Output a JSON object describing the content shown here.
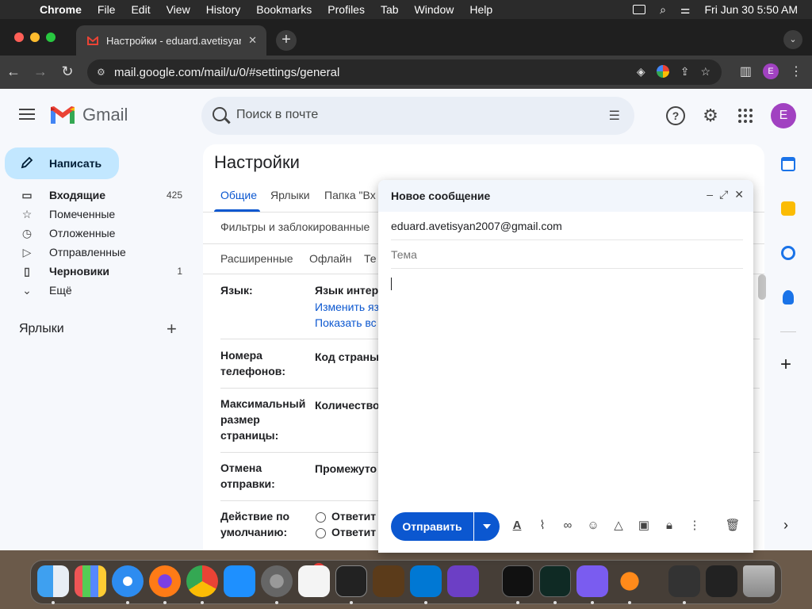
{
  "menubar": {
    "app": "Chrome",
    "items": [
      "File",
      "Edit",
      "View",
      "History",
      "Bookmarks",
      "Profiles",
      "Tab",
      "Window",
      "Help"
    ],
    "clock": "Fri Jun 30  5:50 AM"
  },
  "browser": {
    "tab_title": "Настройки - eduard.avetisyan",
    "url": "mail.google.com/mail/u/0/#settings/general",
    "profile_initial": "E"
  },
  "gmail": {
    "logo_text": "Gmail",
    "search_placeholder": "Поиск в почте",
    "avatar_initial": "E",
    "compose_label": "Написать",
    "nav": [
      {
        "label": "Входящие",
        "count": "425"
      },
      {
        "label": "Помеченные",
        "count": ""
      },
      {
        "label": "Отложенные",
        "count": ""
      },
      {
        "label": "Отправленные",
        "count": ""
      },
      {
        "label": "Черновики",
        "count": "1"
      },
      {
        "label": "Ещё",
        "count": ""
      }
    ],
    "labels_header": "Ярлыки"
  },
  "settings": {
    "title": "Настройки",
    "tabs": [
      "Общие",
      "Ярлыки",
      "Папка \"Вх",
      "Фильтры и заблокированные",
      "Расширенные",
      "Офлайн",
      "Те"
    ],
    "rows": {
      "language": {
        "label": "Язык:",
        "value": "Язык интер",
        "link1": "Изменить яз",
        "link2": "Показать вс"
      },
      "phones": {
        "label": "Номера телефонов:",
        "value": "Код страны"
      },
      "page_size": {
        "label": "Максимальный размер страницы:",
        "value": "Количество"
      },
      "undo_send": {
        "label": "Отмена отправки:",
        "value": "Промежуто"
      },
      "default_action": {
        "label": "Действие по умолчанию:",
        "option1": "Ответит",
        "option2": "Ответит"
      }
    }
  },
  "compose": {
    "title": "Новое сообщение",
    "to": "eduard.avetisyan2007@gmail.com",
    "subject_placeholder": "Тема",
    "send_label": "Отправить"
  },
  "colors": {
    "accent": "#0b57d0",
    "compose_btn_bg": "#c2e7ff",
    "avatar": "#a142c1"
  }
}
